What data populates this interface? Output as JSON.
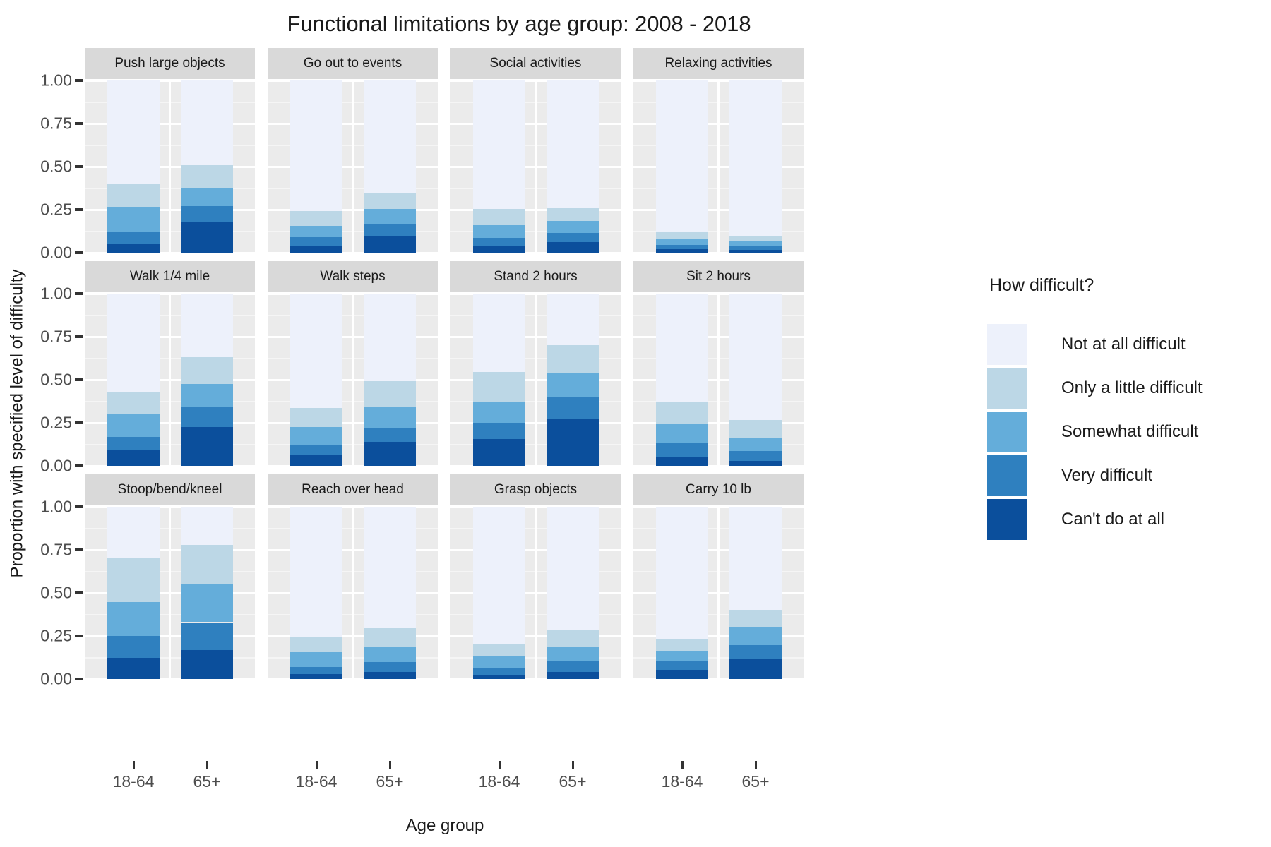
{
  "chart_data": {
    "type": "bar",
    "subtype": "stacked-proportion",
    "title": "Functional limitations by age group: 2008 - 2018",
    "xlabel": "Age group",
    "ylabel": "Proportion with specified level of difficulty",
    "ylim": [
      0,
      1.0
    ],
    "ytick_labels": [
      "0.00",
      "0.25",
      "0.50",
      "0.75",
      "1.00"
    ],
    "ytick_values": [
      0.0,
      0.25,
      0.5,
      0.75,
      1.0
    ],
    "grid": true,
    "categories": [
      "18-64",
      "65+"
    ],
    "legend_title": "How difficult?",
    "legend_position": "right",
    "series": [
      {
        "name": "Not at all difficult",
        "color": "#edf1fb"
      },
      {
        "name": "Only a little difficult",
        "color": "#bcd7e6"
      },
      {
        "name": "Somewhat difficult",
        "color": "#64adda"
      },
      {
        "name": "Very difficult",
        "color": "#2f80bf"
      },
      {
        "name": "Can't do at all",
        "color": "#0b4f9c"
      }
    ],
    "facet_layout": {
      "rows": 3,
      "cols": 4
    },
    "facets": [
      {
        "label": "Push large objects",
        "bars": [
          {
            "category": "18-64",
            "values": [
              0.6,
              0.135,
              0.145,
              0.07,
              0.05
            ]
          },
          {
            "category": "65+",
            "values": [
              0.49,
              0.135,
              0.105,
              0.095,
              0.175
            ]
          }
        ]
      },
      {
        "label": "Go out to events",
        "bars": [
          {
            "category": "18-64",
            "values": [
              0.76,
              0.085,
              0.065,
              0.05,
              0.04
            ]
          },
          {
            "category": "65+",
            "values": [
              0.655,
              0.09,
              0.085,
              0.075,
              0.095
            ]
          }
        ]
      },
      {
        "label": "Social activities",
        "bars": [
          {
            "category": "18-64",
            "values": [
              0.745,
              0.095,
              0.075,
              0.05,
              0.035
            ]
          },
          {
            "category": "65+",
            "values": [
              0.74,
              0.075,
              0.07,
              0.055,
              0.06
            ]
          }
        ]
      },
      {
        "label": "Relaxing activities",
        "bars": [
          {
            "category": "18-64",
            "values": [
              0.88,
              0.04,
              0.035,
              0.025,
              0.02
            ]
          },
          {
            "category": "65+",
            "values": [
              0.905,
              0.03,
              0.03,
              0.02,
              0.015
            ]
          }
        ]
      },
      {
        "label": "Walk 1/4 mile",
        "bars": [
          {
            "category": "18-64",
            "values": [
              0.57,
              0.13,
              0.13,
              0.08,
              0.09
            ]
          },
          {
            "category": "65+",
            "values": [
              0.37,
              0.155,
              0.135,
              0.115,
              0.225
            ]
          }
        ]
      },
      {
        "label": "Walk steps",
        "bars": [
          {
            "category": "18-64",
            "values": [
              0.665,
              0.11,
              0.1,
              0.065,
              0.06
            ]
          },
          {
            "category": "65+",
            "values": [
              0.51,
              0.145,
              0.125,
              0.08,
              0.14
            ]
          }
        ]
      },
      {
        "label": "Stand 2 hours",
        "bars": [
          {
            "category": "18-64",
            "values": [
              0.455,
              0.17,
              0.125,
              0.095,
              0.155
            ]
          },
          {
            "category": "65+",
            "values": [
              0.3,
              0.165,
              0.135,
              0.13,
              0.27
            ]
          }
        ]
      },
      {
        "label": "Sit 2 hours",
        "bars": [
          {
            "category": "18-64",
            "values": [
              0.625,
              0.135,
              0.105,
              0.08,
              0.055
            ]
          },
          {
            "category": "65+",
            "values": [
              0.735,
              0.105,
              0.075,
              0.055,
              0.03
            ]
          }
        ]
      },
      {
        "label": "Stoop/bend/kneel",
        "bars": [
          {
            "category": "18-64",
            "values": [
              0.295,
              0.26,
              0.195,
              0.125,
              0.125
            ]
          },
          {
            "category": "65+",
            "values": [
              0.22,
              0.225,
              0.225,
              0.16,
              0.17
            ]
          }
        ]
      },
      {
        "label": "Reach over head",
        "bars": [
          {
            "category": "18-64",
            "values": [
              0.76,
              0.085,
              0.085,
              0.04,
              0.03
            ]
          },
          {
            "category": "65+",
            "values": [
              0.705,
              0.105,
              0.09,
              0.06,
              0.04
            ]
          }
        ]
      },
      {
        "label": "Grasp objects",
        "bars": [
          {
            "category": "18-64",
            "values": [
              0.8,
              0.065,
              0.07,
              0.045,
              0.02
            ]
          },
          {
            "category": "65+",
            "values": [
              0.715,
              0.095,
              0.085,
              0.065,
              0.04
            ]
          }
        ]
      },
      {
        "label": "Carry 10 lb",
        "bars": [
          {
            "category": "18-64",
            "values": [
              0.77,
              0.07,
              0.055,
              0.05,
              0.055
            ]
          },
          {
            "category": "65+",
            "values": [
              0.6,
              0.095,
              0.11,
              0.075,
              0.12
            ]
          }
        ]
      }
    ]
  },
  "legend": {
    "title": "How difficult?",
    "items": [
      {
        "label": "Not at all difficult",
        "color": "#edf1fb"
      },
      {
        "label": "Only a little difficult",
        "color": "#bcd7e6"
      },
      {
        "label": "Somewhat difficult",
        "color": "#64adda"
      },
      {
        "label": "Very difficult",
        "color": "#2f80bf"
      },
      {
        "label": "Can't do at all",
        "color": "#0b4f9c"
      }
    ]
  },
  "axes": {
    "x_title": "Age group",
    "y_title": "Proportion with specified level of difficulty",
    "x_categories": [
      "18-64",
      "65+"
    ],
    "y_tick_labels": [
      "1.00",
      "0.75",
      "0.50",
      "0.25",
      "0.00"
    ]
  },
  "header": {
    "title": "Functional limitations by age group: 2008 - 2018"
  }
}
